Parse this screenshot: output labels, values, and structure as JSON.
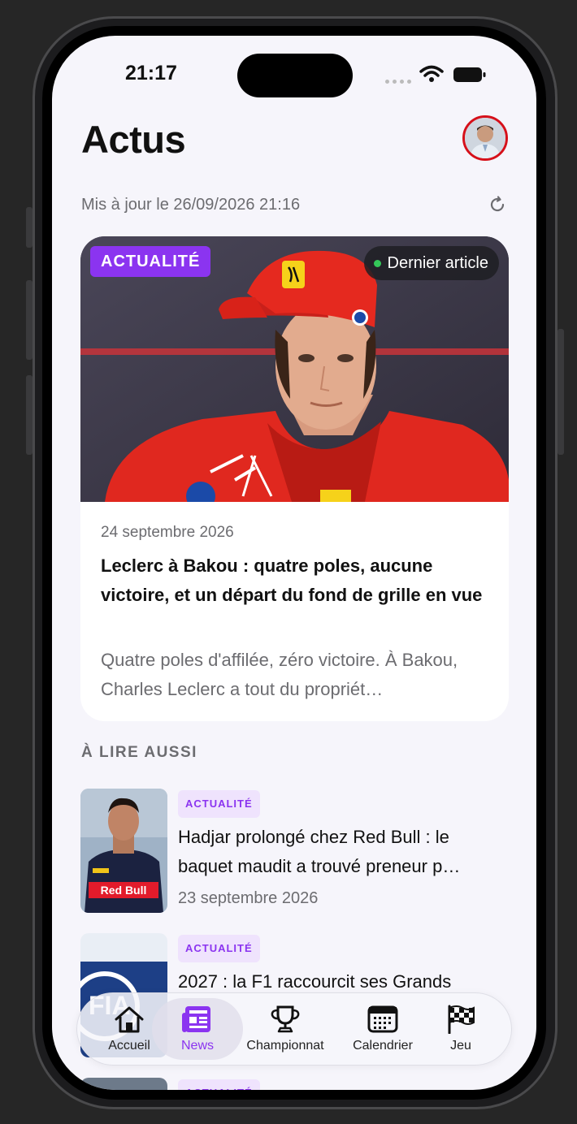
{
  "status_bar": {
    "time": "21:17"
  },
  "header": {
    "title": "Actus"
  },
  "updated_text": "Mis à jour le 26/09/2026 21:16",
  "featured": {
    "badge": "ACTUALITÉ",
    "pill": "Dernier article",
    "date": "24 septembre 2026",
    "title": "Leclerc à Bakou : quatre poles, aucune victoire, et un départ du fond de grille en vue",
    "excerpt": "Quatre poles d'affilée, zéro victoire. À Bakou, Charles Leclerc a tout du propriét…"
  },
  "section_title": "À LIRE AUSSI",
  "articles": [
    {
      "tag": "ACTUALITÉ",
      "title": "Hadjar prolongé chez Red Bull : le baquet maudit a trouvé preneur p…",
      "date": "23 septembre 2026"
    },
    {
      "tag": "ACTUALITÉ",
      "title": "2027 : la F1 raccourcit ses Grands",
      "date": ""
    },
    {
      "tag": "ACTUALITÉ",
      "title": "",
      "date": ""
    }
  ],
  "tabs": [
    {
      "label": "Accueil",
      "icon": "home-icon"
    },
    {
      "label": "News",
      "icon": "newspaper-icon"
    },
    {
      "label": "Championnat",
      "icon": "trophy-icon"
    },
    {
      "label": "Calendrier",
      "icon": "calendar-icon"
    },
    {
      "label": "Jeu",
      "icon": "checkered-flag-icon"
    }
  ],
  "colors": {
    "accent": "#8b34f0",
    "ferrari_red": "#d6101a",
    "live_dot": "#34c759"
  }
}
